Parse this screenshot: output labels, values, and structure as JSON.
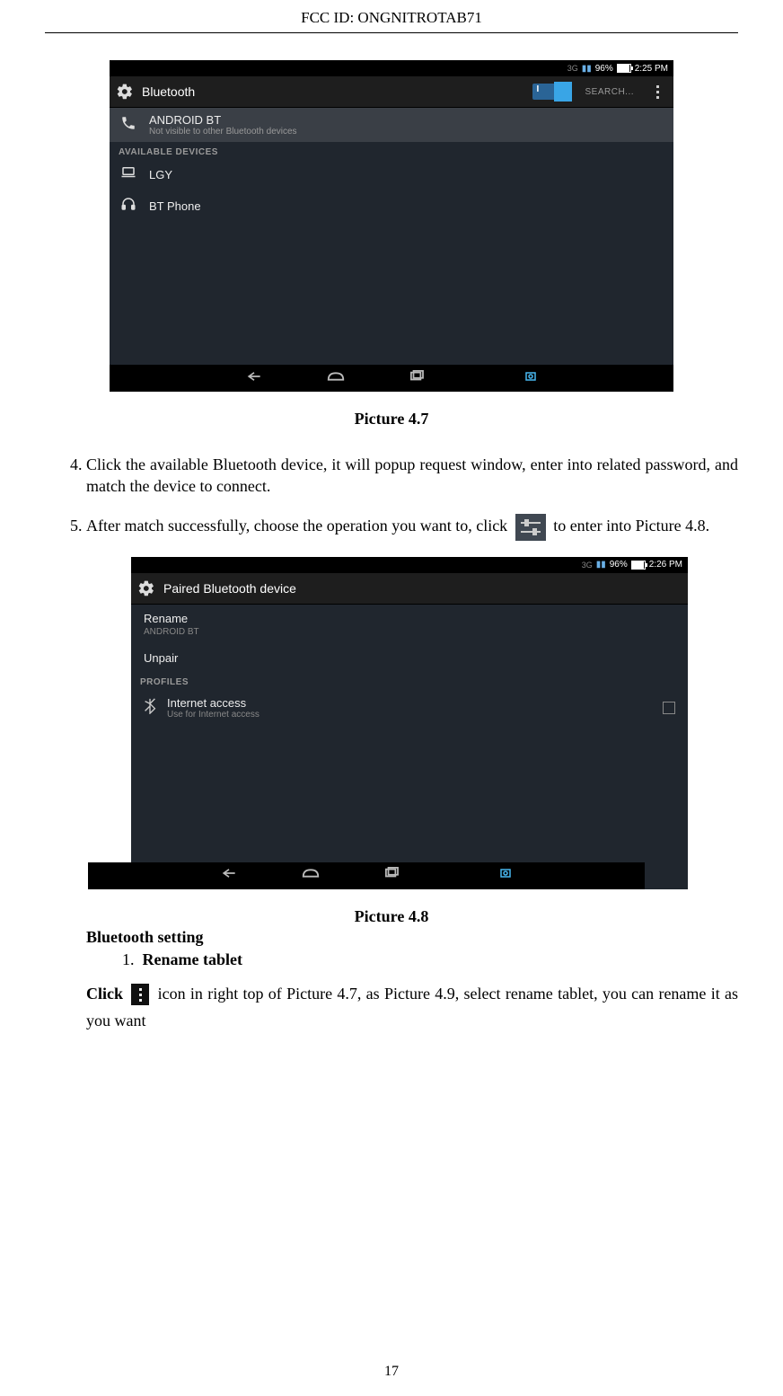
{
  "header": {
    "fcc": "FCC ID:  ONGNITROTAB71"
  },
  "shot1": {
    "status": {
      "signal": "3G",
      "battery_pct": "96%",
      "time": "2:25 PM"
    },
    "appbar": {
      "title": "Bluetooth",
      "toggle_label": "I",
      "search": "SEARCH...",
      "menu": "⋮"
    },
    "self": {
      "name": "ANDROID BT",
      "sub": "Not visible to other Bluetooth devices"
    },
    "section": "AVAILABLE DEVICES",
    "devices": [
      {
        "icon": "laptop",
        "name": "LGY"
      },
      {
        "icon": "headphones",
        "name": "BT Phone"
      }
    ]
  },
  "caption1": "Picture 4.7",
  "steps": {
    "s4": "Click the available Bluetooth device, it will popup request window, enter into related password, and match the device to connect.",
    "s5a": "After match successfully, choose the operation you want to, click ",
    "s5b": " to enter into Picture 4.8."
  },
  "shot2": {
    "status": {
      "signal": "3G",
      "battery_pct": "96%",
      "time": "2:26 PM"
    },
    "appbar": {
      "title": "Paired Bluetooth device"
    },
    "rename": {
      "label": "Rename",
      "value": "ANDROID BT"
    },
    "unpair": "Unpair",
    "section": "PROFILES",
    "profile": {
      "name": "Internet access",
      "sub": "Use for Internet access"
    }
  },
  "caption2": "Picture 4.8",
  "bt_setting_heading": "Bluetooth setting",
  "rename_item_num": "1.",
  "rename_item": "Rename tablet",
  "para_a": "Click ",
  "para_b": " icon in right top of Picture 4.7, as Picture 4.9, select rename tablet, you can rename it as you want",
  "page_number": "17"
}
